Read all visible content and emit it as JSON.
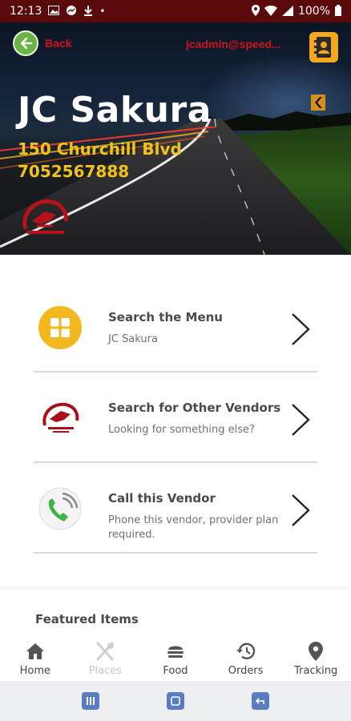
{
  "status_bar": {
    "time": "12:13",
    "battery": "100%"
  },
  "header": {
    "back_label": "Back",
    "user_email": "jcadmin@speed...",
    "vendor_name": "JC Sakura",
    "address": "150 Churchill Blvd",
    "phone": "7052567888"
  },
  "actions": [
    {
      "title": "Search the Menu",
      "subtitle": "JC Sakura",
      "icon": "menu-grid-icon"
    },
    {
      "title": "Search for Other Vendors",
      "subtitle": "Looking for something else?",
      "icon": "vendor-logo-icon"
    },
    {
      "title": "Call this Vendor",
      "subtitle": "Phone this vendor, provider plan required.",
      "icon": "phone-icon"
    }
  ],
  "featured": {
    "title": "Featured Items"
  },
  "tabs": [
    {
      "label": "Home",
      "icon": "home-icon",
      "enabled": true
    },
    {
      "label": "Places",
      "icon": "utensils-icon",
      "enabled": false
    },
    {
      "label": "Food",
      "icon": "burger-icon",
      "enabled": true
    },
    {
      "label": "Orders",
      "icon": "history-icon",
      "enabled": true
    },
    {
      "label": "Tracking",
      "icon": "location-pin-icon",
      "enabled": true
    }
  ],
  "colors": {
    "accent_red": "#d0131b",
    "accent_yellow": "#f1c21b",
    "back_green": "#6bb347",
    "contact_orange": "#f3a81f"
  }
}
